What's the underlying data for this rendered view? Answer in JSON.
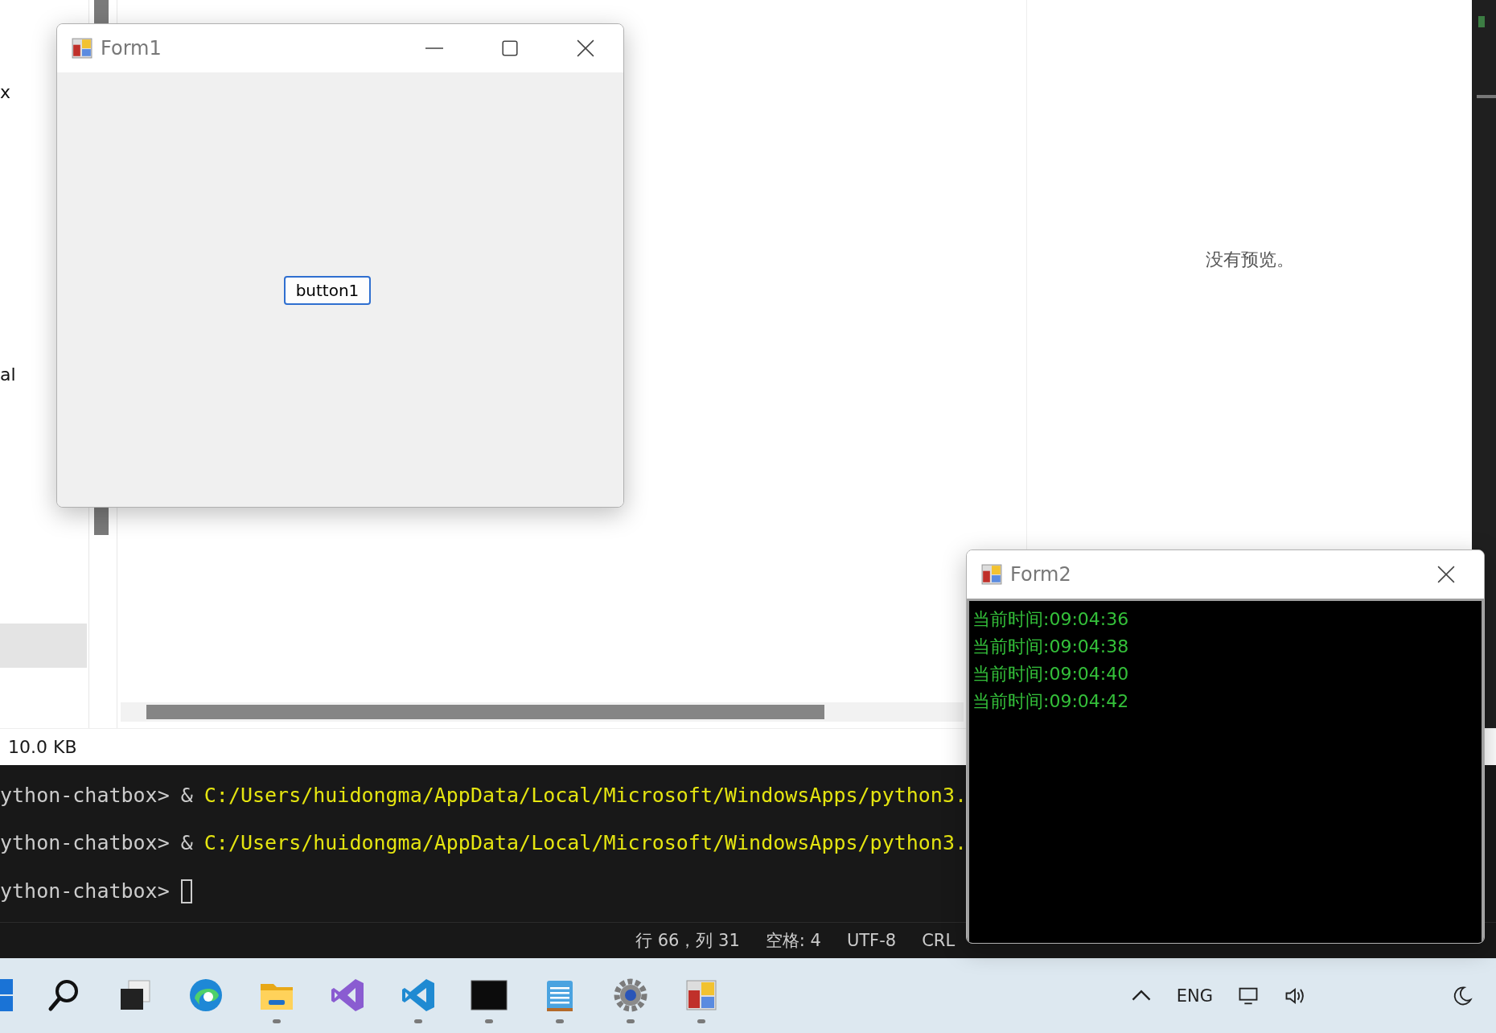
{
  "explorer": {
    "fragments": [
      "x",
      "al"
    ]
  },
  "file_size": "10.0 KB",
  "preview": {
    "message": "没有预览。"
  },
  "terminal": {
    "lines": [
      {
        "prompt": "ython-chatbox>",
        "operator": "&",
        "command": "C:/Users/huidongma/AppData/Local/Microsoft/WindowsApps/python3.",
        "cursor": false
      },
      {
        "prompt": "ython-chatbox>",
        "operator": "&",
        "command": "C:/Users/huidongma/AppData/Local/Microsoft/WindowsApps/python3.",
        "cursor": false
      },
      {
        "prompt": "ython-chatbox>",
        "cursor": true
      }
    ]
  },
  "status_bar": [
    "行 66，列 31",
    "空格: 4",
    "UTF-8",
    "CRL"
  ],
  "form1": {
    "title": "Form1",
    "button": "button1"
  },
  "form2": {
    "title": "Form2",
    "lines": [
      "当前时间:09:04:36",
      "当前时间:09:04:38",
      "当前时间:09:04:40",
      "当前时间:09:04:42"
    ]
  },
  "taskbar": {
    "apps": [
      {
        "kind": "start",
        "running": false
      },
      {
        "kind": "search",
        "running": false
      },
      {
        "kind": "taskview",
        "running": false
      },
      {
        "kind": "edge",
        "running": false
      },
      {
        "kind": "folder",
        "running": true
      },
      {
        "kind": "visualstudio",
        "running": false
      },
      {
        "kind": "vscode",
        "running": true
      },
      {
        "kind": "terminal",
        "running": true
      },
      {
        "kind": "notepad",
        "running": true
      },
      {
        "kind": "settings",
        "running": true
      },
      {
        "kind": "winform",
        "running": true
      }
    ],
    "language": "ENG"
  }
}
